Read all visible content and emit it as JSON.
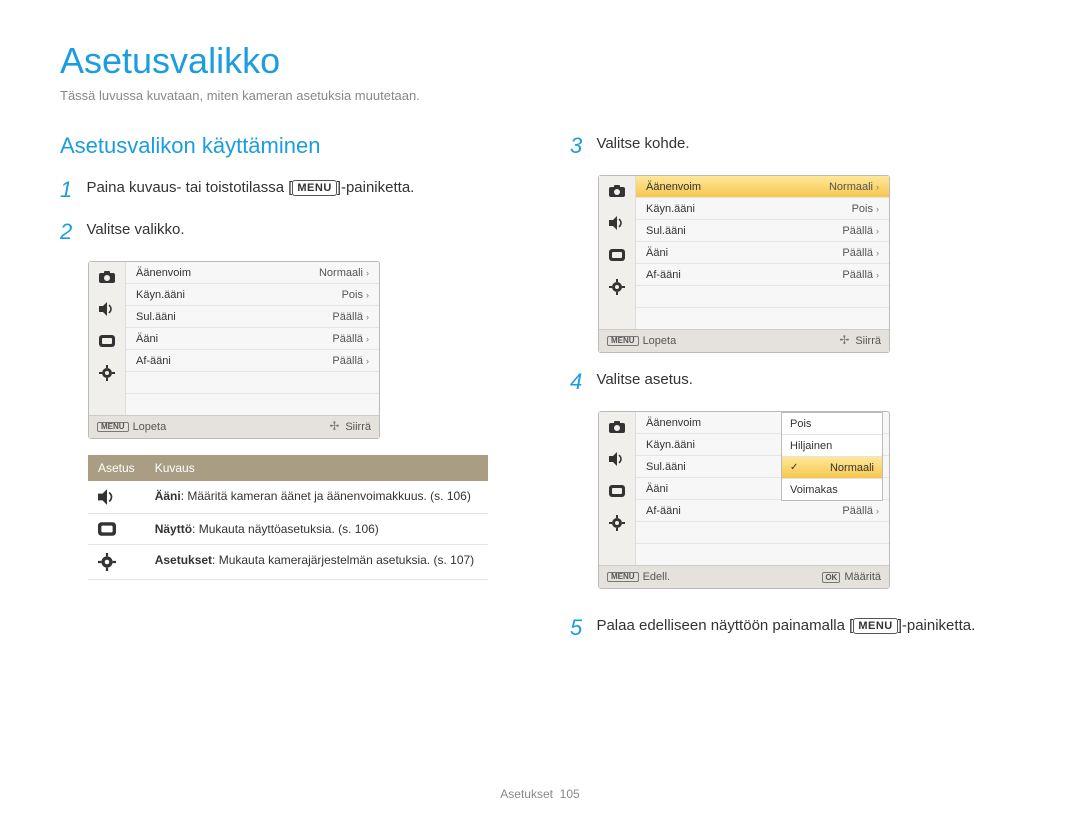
{
  "title": "Asetusvalikko",
  "intro": "Tässä luvussa kuvataan, miten kameran asetuksia muutetaan.",
  "section": "Asetusvalikon käyttäminen",
  "menu_label": "MENU",
  "steps": {
    "s1": {
      "num": "1",
      "text_before": "Paina kuvaus- tai toistotilassa [",
      "text_after": "]-painiketta."
    },
    "s2": {
      "num": "2",
      "text": "Valitse valikko."
    },
    "s3": {
      "num": "3",
      "text": "Valitse kohde."
    },
    "s4": {
      "num": "4",
      "text": "Valitse asetus."
    },
    "s5": {
      "num": "5",
      "text_before": "Palaa edelliseen näyttöön painamalla [",
      "text_after": "]-painiketta."
    }
  },
  "lcd_common": {
    "foot_exit": "Lopeta",
    "foot_move": "Siirrä",
    "foot_back": "Edell.",
    "foot_set": "Määritä"
  },
  "lcd1": {
    "rows": [
      {
        "l": "Äänenvoim",
        "r": "Normaali"
      },
      {
        "l": "Käyn.ääni",
        "r": "Pois"
      },
      {
        "l": "Sul.ääni",
        "r": "Päällä"
      },
      {
        "l": "Ääni",
        "r": "Päällä"
      },
      {
        "l": "Af-ääni",
        "r": "Päällä"
      }
    ]
  },
  "lcd2": {
    "rows": [
      {
        "l": "Äänenvoim",
        "r": "Normaali",
        "hl": true
      },
      {
        "l": "Käyn.ääni",
        "r": "Pois"
      },
      {
        "l": "Sul.ääni",
        "r": "Päällä"
      },
      {
        "l": "Ääni",
        "r": "Päällä"
      },
      {
        "l": "Af-ääni",
        "r": "Päällä"
      }
    ]
  },
  "lcd3": {
    "left_rows": [
      {
        "l": "Äänenvoim"
      },
      {
        "l": "Käyn.ääni"
      },
      {
        "l": "Sul.ääni"
      },
      {
        "l": "Ääni"
      },
      {
        "l": "Af-ääni",
        "r": "Päällä"
      }
    ],
    "overlay": [
      {
        "l": "Pois"
      },
      {
        "l": "Hiljainen"
      },
      {
        "l": "Normaali",
        "chk": true,
        "hl": true
      },
      {
        "l": "Voimakas"
      }
    ]
  },
  "settings_table": {
    "head_a": "Asetus",
    "head_b": "Kuvaus",
    "rows": [
      {
        "icon": "sound",
        "bold": "Ääni",
        "text": ": Määritä kameran äänet ja äänenvoimakkuus. (s. 106)"
      },
      {
        "icon": "display",
        "bold": "Näyttö",
        "text": ": Mukauta näyttöasetuksia. (s. 106)"
      },
      {
        "icon": "gear",
        "bold": "Asetukset",
        "text": ": Mukauta kamerajärjestelmän asetuksia. (s. 107)"
      }
    ]
  },
  "footer": {
    "section": "Asetukset",
    "page": "105"
  }
}
